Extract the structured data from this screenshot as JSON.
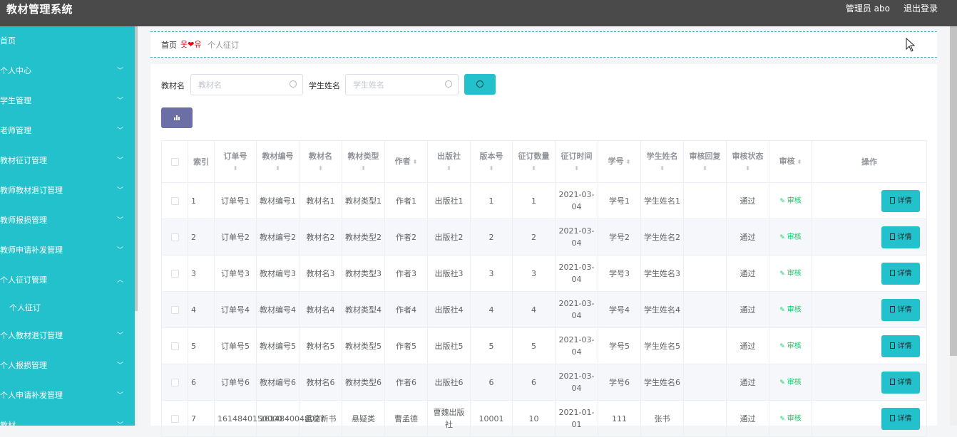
{
  "app": {
    "title": "教材管理系统",
    "user_label": "管理员 abo",
    "logout_label": "退出登录"
  },
  "sidebar": {
    "items": [
      {
        "label": "首页",
        "chevron": ""
      },
      {
        "label": "个人中心",
        "chevron": "chevron-down"
      },
      {
        "label": "学生管理",
        "chevron": "chevron-down"
      },
      {
        "label": "老师管理",
        "chevron": "chevron-down"
      },
      {
        "label": "教材征订管理",
        "chevron": "chevron-down"
      },
      {
        "label": "教师教材退订管理",
        "chevron": "chevron-down"
      },
      {
        "label": "教师报损管理",
        "chevron": "chevron-down"
      },
      {
        "label": "教师申请补发管理",
        "chevron": "chevron-down"
      },
      {
        "label": "个人征订管理",
        "chevron": "chevron-up"
      },
      {
        "label": "个人征订",
        "sub": true
      },
      {
        "label": "个人教材退订管理",
        "chevron": "chevron-down"
      },
      {
        "label": "个人报损管理",
        "chevron": "chevron-down"
      },
      {
        "label": "个人申请补发管理",
        "chevron": "chevron-down"
      },
      {
        "label": "教材...",
        "chevron": "chevron-down"
      }
    ]
  },
  "breadcrumb": {
    "home": "首页",
    "separator": "웃❤유",
    "current": "个人征订"
  },
  "search": {
    "field1_label": "教材名",
    "field1_placeholder": "教材名",
    "field1_value": "",
    "field2_label": "学生姓名",
    "field2_placeholder": "学生姓名",
    "field2_value": ""
  },
  "table": {
    "columns": [
      {
        "label": "",
        "type": "checkbox"
      },
      {
        "label": "索引",
        "sort": "none"
      },
      {
        "label": "订单号",
        "sort": "below"
      },
      {
        "label": "教材编号",
        "sort": "below"
      },
      {
        "label": "教材名",
        "sort": "below"
      },
      {
        "label": "教材类型",
        "sort": "below"
      },
      {
        "label": "作者",
        "sort": "inline"
      },
      {
        "label": "出版社",
        "sort": "below"
      },
      {
        "label": "版本号",
        "sort": "below"
      },
      {
        "label": "征订数量",
        "sort": "below"
      },
      {
        "label": "征订时间",
        "sort": "below"
      },
      {
        "label": "学号",
        "sort": "inline"
      },
      {
        "label": "学生姓名",
        "sort": "below"
      },
      {
        "label": "审核回复",
        "sort": "below"
      },
      {
        "label": "审核状态",
        "sort": "below"
      },
      {
        "label": "审核",
        "sort": "inline"
      },
      {
        "label": "操作",
        "sort": "none"
      }
    ],
    "audit_label": "审核",
    "detail_label": "详情",
    "rows": [
      [
        "1",
        "订单号1",
        "教材编号1",
        "教材名1",
        "教材类型1",
        "作者1",
        "出版社1",
        "1",
        "1",
        "2021-03-04",
        "学号1",
        "学生姓名1",
        "",
        "通过"
      ],
      [
        "2",
        "订单号2",
        "教材编号2",
        "教材名2",
        "教材类型2",
        "作者2",
        "出版社2",
        "2",
        "2",
        "2021-03-04",
        "学号2",
        "学生姓名2",
        "",
        "通过"
      ],
      [
        "3",
        "订单号3",
        "教材编号3",
        "教材名3",
        "教材类型3",
        "作者3",
        "出版社3",
        "3",
        "3",
        "2021-03-04",
        "学号3",
        "学生姓名3",
        "",
        "通过"
      ],
      [
        "4",
        "订单号4",
        "教材编号4",
        "教材名4",
        "教材类型4",
        "作者4",
        "出版社4",
        "4",
        "4",
        "2021-03-04",
        "学号4",
        "学生姓名4",
        "",
        "通过"
      ],
      [
        "5",
        "订单号5",
        "教材编号5",
        "教材名5",
        "教材类型5",
        "作者5",
        "出版社5",
        "5",
        "5",
        "2021-03-04",
        "学号5",
        "学生姓名5",
        "",
        "通过"
      ],
      [
        "6",
        "订单号6",
        "教材编号6",
        "教材名6",
        "教材类型6",
        "作者6",
        "出版社6",
        "6",
        "6",
        "2021-03-04",
        "学号6",
        "学生姓名6",
        "",
        "通过"
      ],
      [
        "7",
        "1614840150000",
        "1614840048027",
        "孟德新书",
        "悬疑类",
        "曹孟德",
        "曹魏出版社",
        "10001",
        "10",
        "2021-01-01",
        "111",
        "张书",
        "",
        "通过"
      ]
    ]
  }
}
